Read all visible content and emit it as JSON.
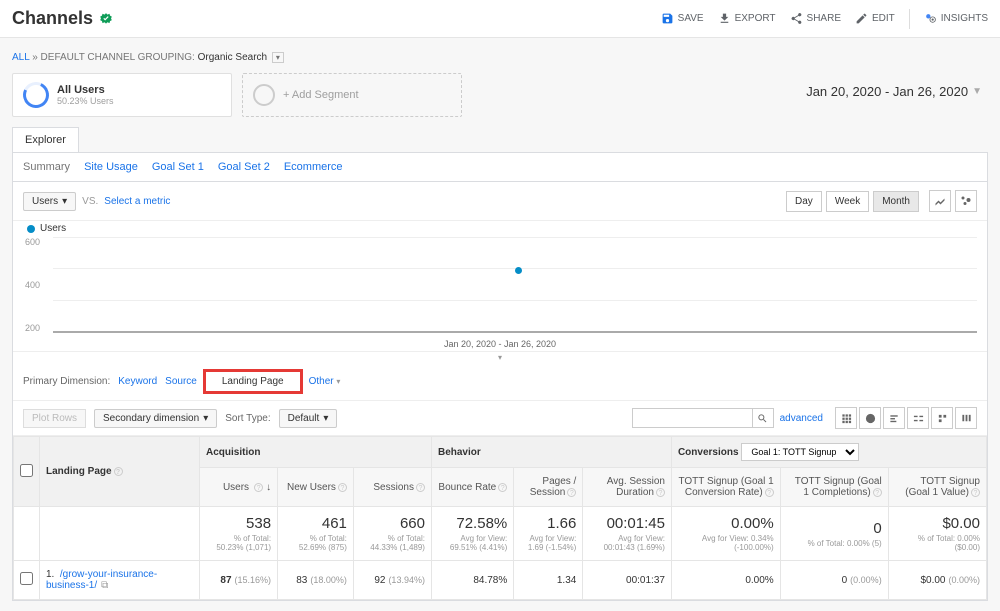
{
  "page_title": "Channels",
  "actions": {
    "save": "SAVE",
    "export": "EXPORT",
    "share": "SHARE",
    "edit": "EDIT",
    "insights": "INSIGHTS"
  },
  "breadcrumb": {
    "l1": "ALL",
    "sep": "»",
    "l2": "DEFAULT CHANNEL GROUPING:",
    "sel": "Organic Search"
  },
  "date_range": "Jan 20, 2020 - Jan 26, 2020",
  "segments": {
    "all_users_title": "All Users",
    "all_users_sub": "50.23% Users",
    "add": "+ Add Segment"
  },
  "tab": "Explorer",
  "subtabs": {
    "summary": "Summary",
    "site_usage": "Site Usage",
    "goal1": "Goal Set 1",
    "goal2": "Goal Set 2",
    "ecommerce": "Ecommerce"
  },
  "metric_selector": {
    "primary": "Users",
    "vs": "VS.",
    "secondary": "Select a metric"
  },
  "granularity": {
    "day": "Day",
    "week": "Week",
    "month": "Month"
  },
  "chart_data": {
    "type": "scatter",
    "series_name": "Users",
    "y_ticks": [
      "600",
      "400",
      "200"
    ],
    "x_label": "Jan 20, 2020 - Jan 26, 2020",
    "points": [
      {
        "x": 0.5,
        "y": 538
      }
    ],
    "ylim": [
      0,
      700
    ]
  },
  "primary_dimension": {
    "label": "Primary Dimension:",
    "keyword": "Keyword",
    "source": "Source",
    "landing_page": "Landing Page",
    "other": "Other"
  },
  "table_controls": {
    "plot_rows": "Plot Rows",
    "secondary_dim": "Secondary dimension",
    "sort_type": "Sort Type:",
    "sort_default": "Default",
    "advanced": "advanced"
  },
  "table": {
    "groups": {
      "acquisition": "Acquisition",
      "behavior": "Behavior",
      "conversions": "Conversions"
    },
    "goal_selector": "Goal 1: TOTT Signup",
    "landing_page_col": "Landing Page",
    "columns": {
      "users": "Users",
      "new_users": "New Users",
      "sessions": "Sessions",
      "bounce": "Bounce Rate",
      "pps": "Pages / Session",
      "duration": "Avg. Session Duration",
      "conv_rate": "TOTT Signup (Goal 1 Conversion Rate)",
      "completions": "TOTT Signup (Goal 1 Completions)",
      "value": "TOTT Signup (Goal 1 Value)"
    },
    "totals": {
      "users": {
        "v": "538",
        "s": "% of Total: 50.23% (1,071)"
      },
      "new_users": {
        "v": "461",
        "s": "% of Total: 52.69% (875)"
      },
      "sessions": {
        "v": "660",
        "s": "% of Total: 44.33% (1,489)"
      },
      "bounce": {
        "v": "72.58%",
        "s": "Avg for View: 69.51% (4.41%)"
      },
      "pps": {
        "v": "1.66",
        "s": "Avg for View: 1.69 (-1.54%)"
      },
      "duration": {
        "v": "00:01:45",
        "s": "Avg for View: 00:01:43 (1.69%)"
      },
      "conv_rate": {
        "v": "0.00%",
        "s": "Avg for View: 0.34% (-100.00%)"
      },
      "completions": {
        "v": "0",
        "s": "% of Total: 0.00% (5)"
      },
      "value": {
        "v": "$0.00",
        "s": "% of Total: 0.00% ($0.00)"
      }
    },
    "rows": [
      {
        "idx": "1.",
        "lp": "/grow-your-insurance-business-1/",
        "users": "87",
        "users_p": "(15.16%)",
        "new_users": "83",
        "new_users_p": "(18.00%)",
        "sessions": "92",
        "sessions_p": "(13.94%)",
        "bounce": "84.78%",
        "pps": "1.34",
        "duration": "00:01:37",
        "conv_rate": "0.00%",
        "completions": "0",
        "completions_p": "(0.00%)",
        "value": "$0.00",
        "value_p": "(0.00%)"
      }
    ]
  }
}
